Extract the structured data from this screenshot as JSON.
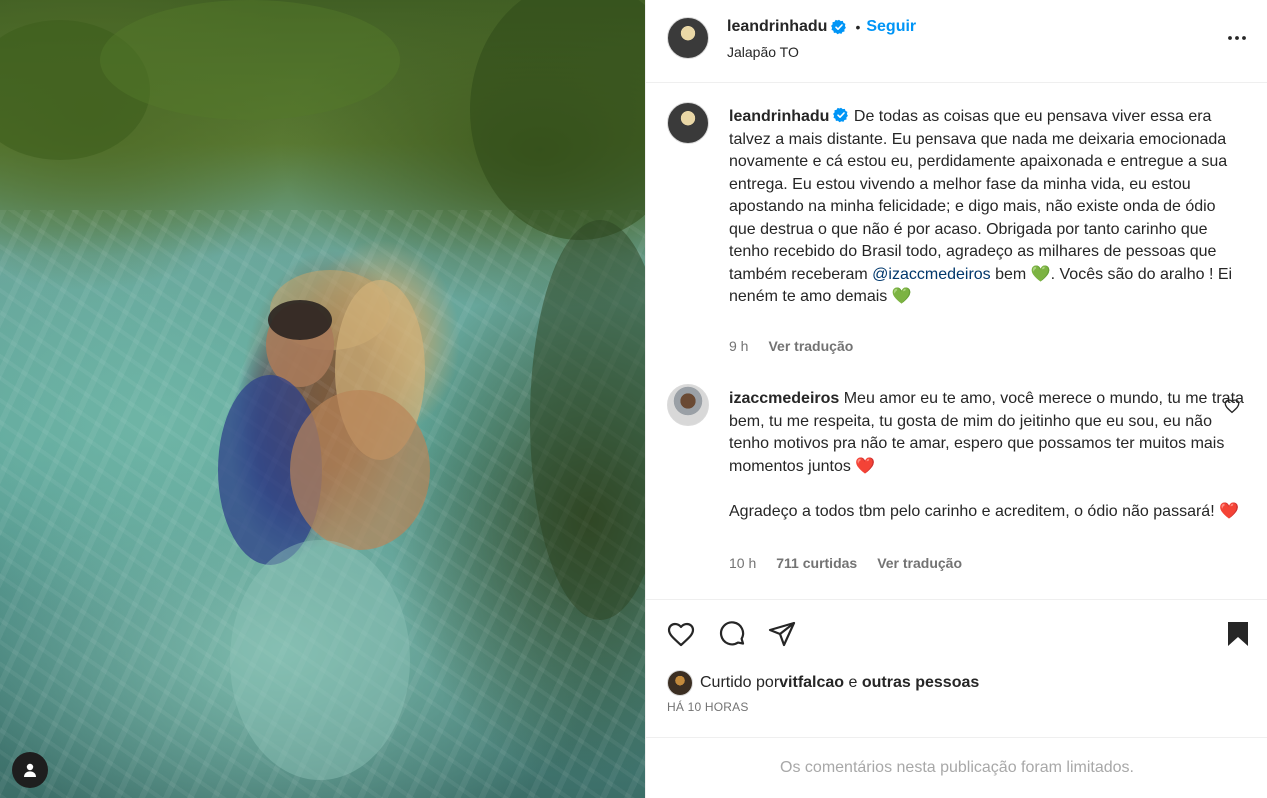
{
  "header": {
    "username": "leandrinhadu",
    "separator": "•",
    "follow_label": "Seguir",
    "location": "Jalapão TO"
  },
  "caption": {
    "username": "leandrinhadu",
    "text_part1": " De todas as coisas que eu pensava viver essa era talvez a mais distante. Eu pensava que nada me deixaria emocionada novamente e cá estou eu, perdidamente apaixonada e entregue a sua entrega. Eu estou vivendo a melhor fase da minha vida, eu estou apostando na minha felicidade; e digo mais, não existe onda de ódio que destrua o que não é por acaso. Obrigada por tanto carinho que tenho recebido do Brasil todo, agradeço as milhares de pessoas que também receberam ",
    "mention": "@izaccmedeiros",
    "text_part2": " bem ",
    "emoji1": "💚",
    "text_part3": ". Vocês são do aralho ! Ei neném te amo demais ",
    "emoji2": "💚",
    "time": "9 h",
    "translate_label": "Ver tradução"
  },
  "comment": {
    "username": "izaccmedeiros",
    "text_part1": " Meu amor eu te amo, você merece o mundo, tu me trata bem, tu me respeita, tu gosta de mim do jeitinho que eu sou, eu não tenho motivos pra não te amar, espero que possamos ter muitos mais momentos juntos ",
    "emoji1": "❤️",
    "text_part2": "Agradeço a todos tbm pelo carinho e acreditem, o ódio não passará! ",
    "emoji2": "❤️",
    "time": "10 h",
    "likes": "711 curtidas",
    "translate_label": "Ver tradução"
  },
  "likes": {
    "prefix": "Curtido por ",
    "user": "vitfalcao",
    "conj": " e ",
    "others": "outras pessoas",
    "time_ago": "HÁ 10 HORAS"
  },
  "footer": {
    "limited_text": "Os comentários nesta publicação foram limitados."
  },
  "icons": {
    "more": "more-options-icon",
    "heart": "heart-icon",
    "comment": "comment-icon",
    "share": "share-icon",
    "save": "bookmark-icon",
    "verified": "verified-badge-icon",
    "account": "account-icon"
  },
  "colors": {
    "link_blue": "#0095f6",
    "mention": "#00376b",
    "muted": "#737373",
    "verified": "#0095f6"
  }
}
